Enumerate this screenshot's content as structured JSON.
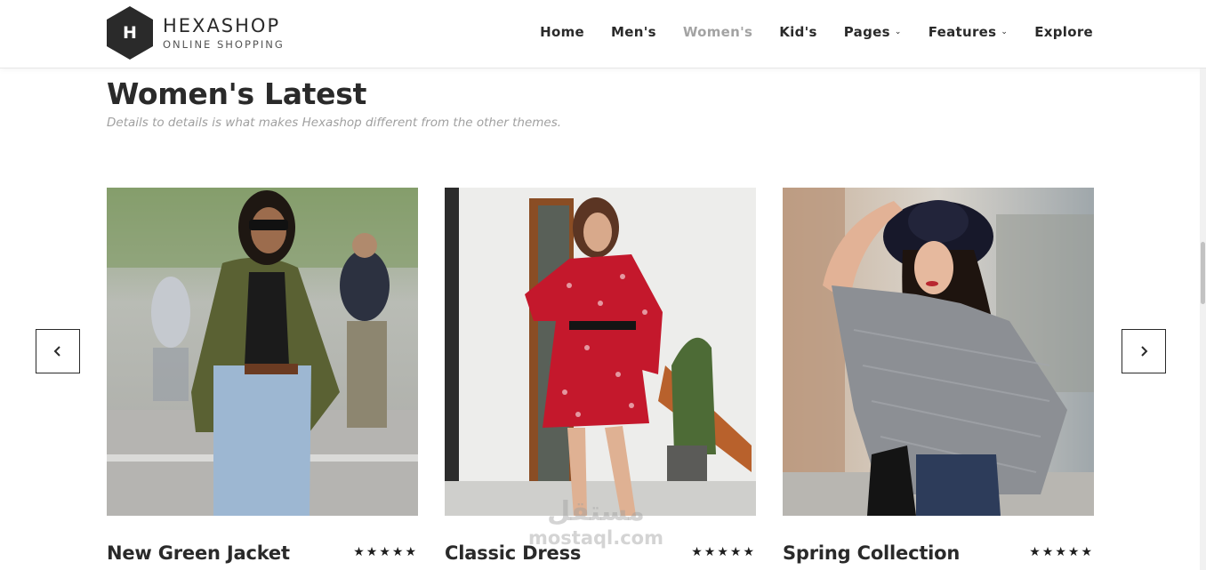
{
  "header": {
    "logo_letter": "H",
    "brand_name": "HEXASHOP",
    "brand_tagline": "ONLINE SHOPPING",
    "nav": [
      {
        "label": "Home"
      },
      {
        "label": "Men's"
      },
      {
        "label": "Women's",
        "active": true
      },
      {
        "label": "Kid's"
      },
      {
        "label": "Pages",
        "has_dropdown": true
      },
      {
        "label": "Features",
        "has_dropdown": true
      },
      {
        "label": "Explore"
      }
    ]
  },
  "section": {
    "title": "Women's Latest",
    "subtitle": "Details to details is what makes Hexashop different from the other themes."
  },
  "carousel": {
    "prev_icon": "chevron-left-icon",
    "next_icon": "chevron-right-icon",
    "products": [
      {
        "name": "New Green Jacket",
        "rating": 5,
        "stars": "★★★★★"
      },
      {
        "name": "Classic Dress",
        "rating": 5,
        "stars": "★★★★★"
      },
      {
        "name": "Spring Collection",
        "rating": 5,
        "stars": "★★★★★"
      }
    ]
  },
  "watermark": {
    "arabic": "مستقل",
    "latin": "mostaql.com"
  },
  "colors": {
    "text_dark": "#2a2a2a",
    "nav_active": "#a3a3a3",
    "subtitle": "#a0a0a0",
    "logo_bg": "#2a2a2a"
  }
}
